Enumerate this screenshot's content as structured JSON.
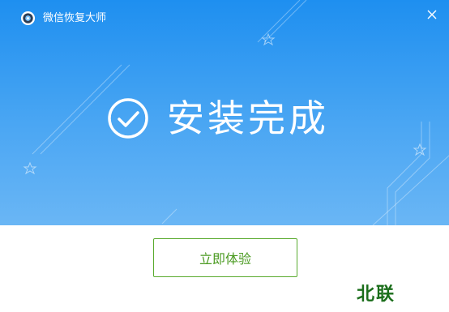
{
  "window": {
    "title": "微信恢复大师",
    "logo_icon": "app-logo-icon",
    "close_icon": "close-icon"
  },
  "hero": {
    "status_icon": "check-circle-icon",
    "status_text": "安装完成"
  },
  "actions": {
    "primary_label": "立即体验"
  },
  "watermark": {
    "text": "北联"
  },
  "colors": {
    "hero_top": "#1e8ff0",
    "hero_bottom": "#6ab6f5",
    "button_border": "#5aab2f",
    "button_text": "#4a9a20",
    "watermark": "#1b6e1b"
  }
}
